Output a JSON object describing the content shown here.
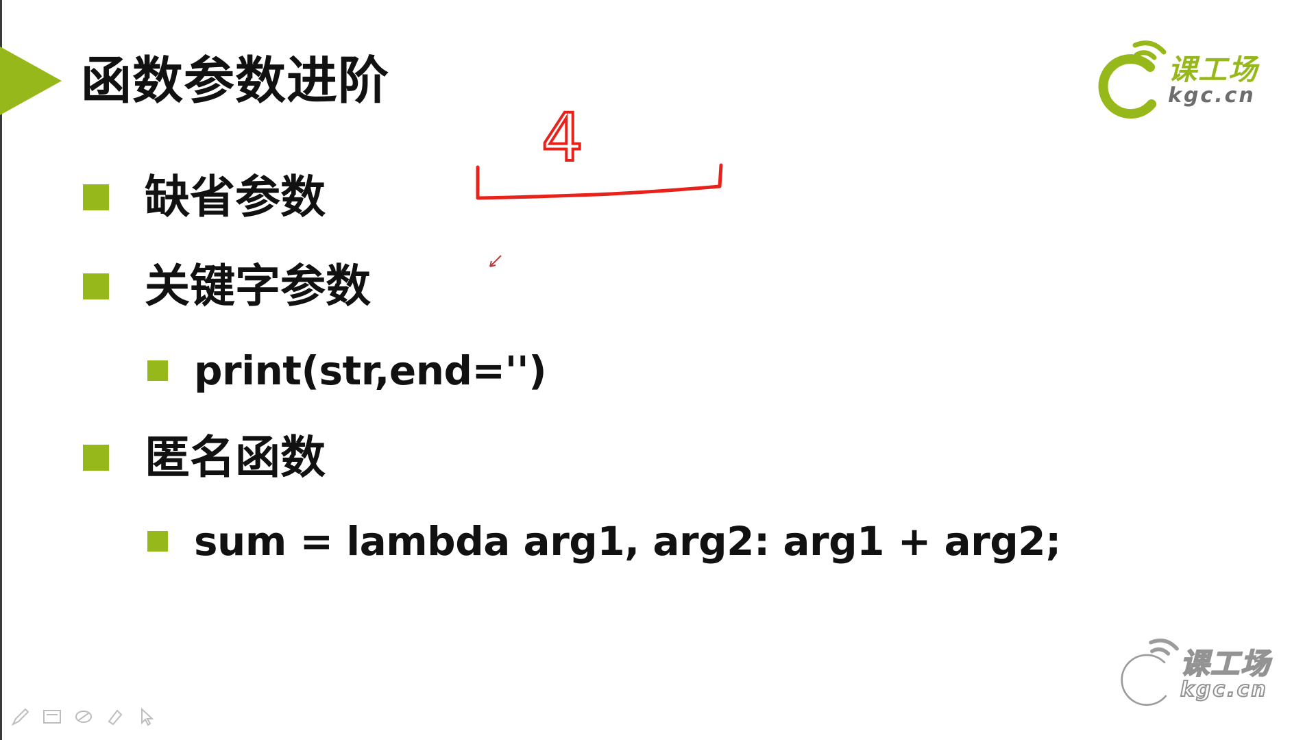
{
  "slide": {
    "title": "函数参数进阶",
    "bullets": [
      {
        "level": 1,
        "text": "缺省参数"
      },
      {
        "level": 1,
        "text": "关键字参数"
      },
      {
        "level": 2,
        "text": "print(str,end='')"
      },
      {
        "level": 1,
        "text": "匿名函数"
      },
      {
        "level": 2,
        "text": "sum = lambda arg1, arg2: arg1 + arg2;"
      }
    ]
  },
  "annotation": {
    "handwritten_text": "4",
    "ink_color": "#e8211b",
    "shape": "bracket"
  },
  "logos": {
    "top_right": {
      "cn": "课工场",
      "en": "kgc.cn"
    },
    "bottom_right_watermark": {
      "cn": "课工场",
      "en": "kgc.cn"
    }
  },
  "toolbar": {
    "tools": [
      "pen-icon",
      "screen-icon",
      "eraser-shape-icon",
      "highlighter-icon",
      "arrow-pointer-icon"
    ]
  },
  "colors": {
    "accent_green": "#97b81a",
    "text": "#111111",
    "logo_gray": "#6d6d6d",
    "ink_red": "#e8211b"
  }
}
